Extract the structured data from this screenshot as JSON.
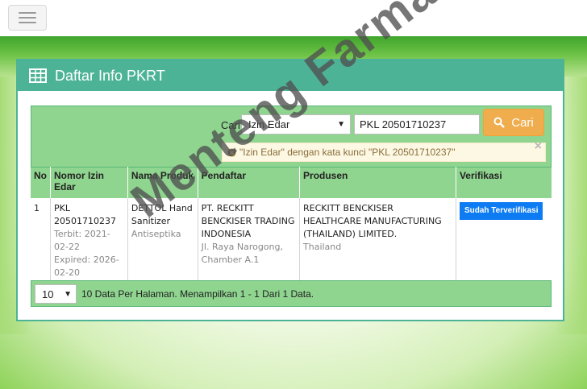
{
  "panel": {
    "title": "Daftar Info PKRT"
  },
  "search": {
    "label": "Cari",
    "field_select_value": "Izin Edar",
    "query_value": "PKL 20501710237",
    "button_label": "Cari",
    "alert_text": "\"Izin Edar\" dengan kata kunci \"PKL 20501710237\""
  },
  "table": {
    "headers": [
      "No",
      "Nomor Izin Edar",
      "Nama Produk",
      "Pendaftar",
      "Produsen",
      "Verifikasi"
    ],
    "rows": [
      {
        "no": "1",
        "nomor": "PKL 20501710237",
        "terbit": "Terbit: 2021-02-22",
        "expired": "Expired: 2026-02-20",
        "nama": "DETTOL Hand Sanitizer",
        "kategori": "Antiseptika",
        "pendaftar": "PT. RECKITT BENCKISER TRADING INDONESIA",
        "alamat": "Jl. Raya Narogong, Chamber A.1",
        "produsen": "RECKITT BENCKISER HEALTHCARE MANUFACTURING (THAILAND) LIMITED.",
        "negara": "Thailand",
        "verifikasi": "Sudah Terverifikasi"
      }
    ]
  },
  "footer": {
    "per_page_value": "10",
    "info_text": "10 Data Per Halaman. Menampilkan 1 - 1 Dari 1 Data."
  },
  "watermark": "Menteng Farma",
  "icons": {
    "table": "table-icon",
    "search": "search-icon",
    "clear": "circle-x-icon",
    "close": "close-icon",
    "menu": "hamburger-icon"
  },
  "colors": {
    "header_teal": "#4db396",
    "table_green": "#8fd48f",
    "button_orange": "#f0ad4e",
    "badge_blue": "#0d7cf2",
    "alert_bg": "#fcf8e3"
  }
}
